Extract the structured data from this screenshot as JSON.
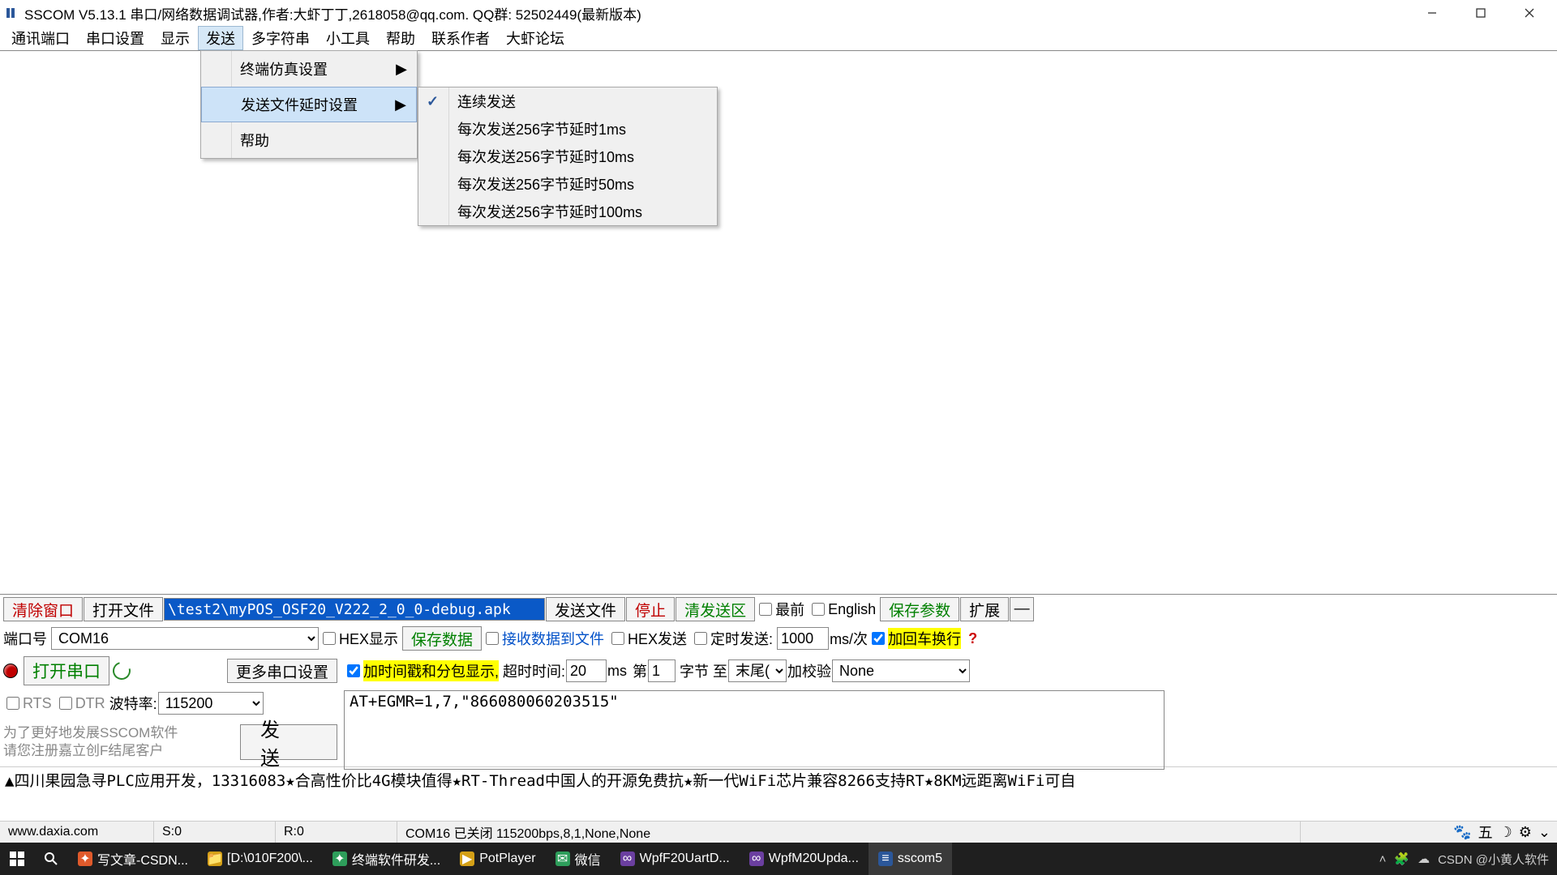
{
  "title": "SSCOM V5.13.1 串口/网络数据调试器,作者:大虾丁丁,2618058@qq.com. QQ群:  52502449(最新版本)",
  "menu": {
    "items": [
      "通讯端口",
      "串口设置",
      "显示",
      "发送",
      "多字符串",
      "小工具",
      "帮助",
      "联系作者",
      "大虾论坛"
    ],
    "activeIndex": 3
  },
  "dd1": {
    "items": [
      {
        "label": "终端仿真设置",
        "arrow": true
      },
      {
        "label": "发送文件延时设置",
        "arrow": true,
        "sel": true
      },
      {
        "label": "帮助"
      }
    ]
  },
  "dd2": {
    "items": [
      {
        "label": "连续发送",
        "checked": true
      },
      {
        "label": "每次发送256字节延时1ms"
      },
      {
        "label": "每次发送256字节延时10ms"
      },
      {
        "label": "每次发送256字节延时50ms"
      },
      {
        "label": "每次发送256字节延时100ms"
      }
    ]
  },
  "row1": {
    "clear": "清除窗口",
    "open": "打开文件",
    "path": "\\test2\\myPOS_OSF20_V222_2_0_0-debug.apk",
    "sendfile": "发送文件",
    "stop": "停止",
    "clearSend": "清发送区",
    "top": "最前",
    "english": "English",
    "saveParam": "保存参数",
    "expand": "扩展",
    "minus": "—"
  },
  "row2": {
    "portLabel": "端口号",
    "port": "COM16",
    "hexShow": "HEX显示",
    "saveData": "保存数据",
    "recvToFile": "接收数据到文件",
    "hexSend": "HEX发送",
    "timedSend": "定时发送:",
    "interval": "1000",
    "intervalUnit": "ms/次",
    "addCR": "加回车换行"
  },
  "row3": {
    "openPort": "打开串口",
    "moreSettings": "更多串口设置",
    "addTs": "加时间戳和分包显示,",
    "timeoutLabel": "超时时间:",
    "timeout": "20",
    "timeoutUnit": "ms",
    "byteLabel1": "第",
    "byte": "1",
    "byteLabel2": "字节",
    "toLabel": "至",
    "tail": "末尾(?",
    "addChk": "加校验",
    "chk": "None"
  },
  "row4": {
    "rts": "RTS",
    "dtr": "DTR",
    "baudLabel": "波特率:",
    "baud": "115200",
    "cmd": "AT+EGMR=1,7,\"866080060203515\""
  },
  "row5": {
    "note1": "为了更好地发展SSCOM软件",
    "note2": "请您注册嘉立创F结尾客户",
    "send": "发   送"
  },
  "ad": "▲四川果园急寻PLC应用开发，13316083★合高性价比4G模块值得★RT-Thread中国人的开源免费抗★新一代WiFi芯片兼容8266支持RT★8KM远距离WiFi可自",
  "status": {
    "url": "www.daxia.com",
    "s": "S:0",
    "r": "R:0",
    "info": "COM16 已关闭  115200bps,8,1,None,None"
  },
  "taskbar": {
    "items": [
      {
        "label": "写文章-CSDN...",
        "color": "#e05a2b"
      },
      {
        "label": "[D:\\010F200\\...",
        "color": "#d4a017"
      },
      {
        "label": "终端软件研发...",
        "color": "#2e9e5b"
      },
      {
        "label": "PotPlayer",
        "color": "#d4a017"
      },
      {
        "label": "微信",
        "color": "#2e9e5b"
      },
      {
        "label": "WpfF20UartD...",
        "color": "#6b3fa0"
      },
      {
        "label": "WpfM20Upda...",
        "color": "#6b3fa0"
      },
      {
        "label": "sscom5",
        "active": true,
        "color": "#2b579a"
      }
    ],
    "tray": "CSDN @小黄人软件"
  }
}
